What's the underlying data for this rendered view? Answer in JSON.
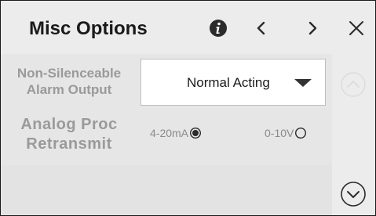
{
  "header": {
    "title": "Misc Options",
    "icons": {
      "info": "info-icon",
      "prev": "chevron-left-icon",
      "next": "chevron-right-icon",
      "close": "close-icon"
    }
  },
  "settings": {
    "alarm_output": {
      "label_line1": "Non-Silenceable",
      "label_line2": "Alarm Output",
      "selected": "Normal Acting"
    },
    "analog_proc": {
      "label_line1": "Analog Proc",
      "label_line2": "Retransmit",
      "options": [
        {
          "label": "4-20mA",
          "selected": true
        },
        {
          "label": "0-10V",
          "selected": false
        }
      ]
    }
  },
  "scroll": {
    "up_icon": "chevron-up-circle-icon",
    "down_icon": "chevron-down-circle-icon",
    "up_enabled": false,
    "down_enabled": true
  },
  "colors": {
    "background": "#ececec",
    "label_text": "#9a9a9a",
    "title_text": "#1a1a1a"
  }
}
